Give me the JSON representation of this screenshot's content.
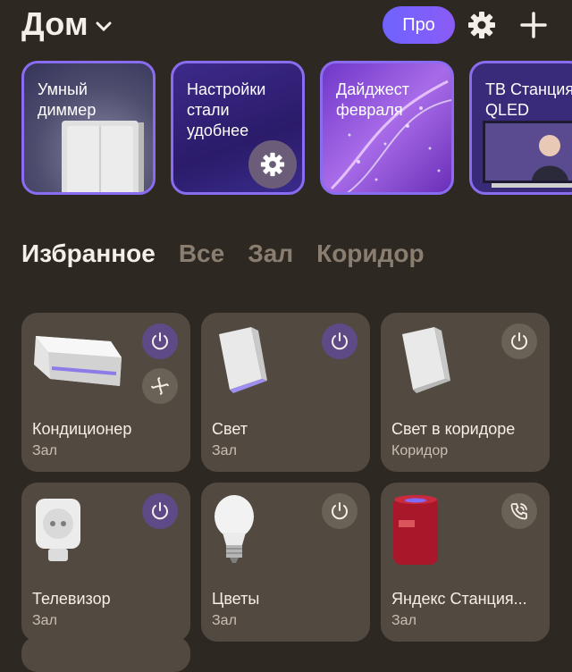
{
  "header": {
    "title": "Дом",
    "pro_label": "Про"
  },
  "stories": [
    {
      "label": "Умный\nдиммер"
    },
    {
      "label": "Настройки\nстали\nудобнее"
    },
    {
      "label": "Дайджест\nфевраля"
    },
    {
      "label": "ТВ Станция\nQLED"
    }
  ],
  "tabs": [
    "Избранное",
    "Все",
    "Зал",
    "Коридор"
  ],
  "devices": [
    {
      "name": "Кондиционер",
      "room": "Зал",
      "power": "on"
    },
    {
      "name": "Свет",
      "room": "Зал",
      "power": "on"
    },
    {
      "name": "Свет в коридоре",
      "room": "Коридор",
      "power": "off"
    },
    {
      "name": "Телевизор",
      "room": "Зал",
      "power": "on"
    },
    {
      "name": "Цветы",
      "room": "Зал",
      "power": "off"
    },
    {
      "name": "Яндекс Станция...",
      "room": "Зал",
      "power": "call"
    }
  ],
  "colors": {
    "background": "#2e2822",
    "card": "#524a41",
    "accent": "#7b5cf6",
    "power_on": "#5d4a87",
    "power_off": "#6a6157"
  },
  "icons": {
    "home_dropdown": "chevron-down-icon",
    "settings": "gear-icon",
    "add": "plus-icon",
    "power": "power-icon",
    "fan": "fan-icon",
    "call": "phone-icon"
  }
}
